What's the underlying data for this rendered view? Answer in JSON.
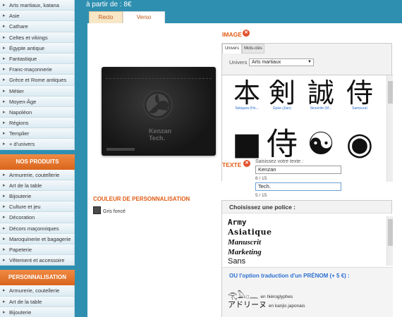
{
  "sidebar": {
    "categories": [
      "Arts martiaux, katana",
      "Asie",
      "Cathare",
      "Celtes et vikings",
      "Égypte antique",
      "Fantastique",
      "Franc-maçonnerie",
      "Grèce et Rome antiques",
      "Métier",
      "Moyen-Âge",
      "Napoléon",
      "Régions",
      "Templier",
      "+ d'univers"
    ],
    "produits_heading": "NOS PRODUITS",
    "produits": [
      "Armurerie, coutellerie",
      "Art de la table",
      "Bijouterie",
      "Culture et jeu",
      "Décoration",
      "Décors maçonniques",
      "Maroquinerie et bagagerie",
      "Papeterie",
      "Vêtement et accessoire"
    ],
    "perso_heading": "PERSONNALISATION",
    "perso": [
      "Armurerie, coutellerie",
      "Art de la table",
      "Bijouterie"
    ]
  },
  "header": {
    "price": "à partir de : 8€"
  },
  "tabs": {
    "recto": "Recto",
    "verso": "Verso"
  },
  "product": {
    "engraving_line1": "Kenzan",
    "engraving_line2": "Tech."
  },
  "couleur": {
    "title": "COULEUR DE PERSONNALISATION",
    "swatch_label": "Gris foncé",
    "swatch_color": "#4a4a4a"
  },
  "image_section": {
    "title": "IMAGE",
    "tab_univers": "Univers",
    "tab_mots": "Mots-clés",
    "univers_label": "Univers :",
    "univers_value": "Arts martiaux",
    "symbols_row1": [
      {
        "glyph": "本",
        "caption": "Sekigara (Ho..."
      },
      {
        "glyph": "剣",
        "caption": "Épée (Jian)"
      },
      {
        "glyph": "誠",
        "caption": "Sincérité (M..."
      },
      {
        "glyph": "侍",
        "caption": "Samouraï"
      }
    ],
    "symbols_row2": [
      {
        "glyph": "■",
        "caption": ""
      },
      {
        "glyph": "侍",
        "caption": ""
      },
      {
        "glyph": "☯",
        "caption": ""
      },
      {
        "glyph": "◉",
        "caption": ""
      }
    ]
  },
  "texte_section": {
    "title": "TEXTE",
    "prompt": "Saisissez votre texte :",
    "line1_value": "Kenzan",
    "line1_count": "6 / 15",
    "line2_value": "Tech.",
    "line2_count": "5 / 15"
  },
  "police_section": {
    "title": "Choisissez une police :",
    "fonts": [
      "Army",
      "Asiatique",
      "Manuscrit",
      "Marketing",
      "Sans"
    ],
    "traduction_title": "OU l'option traduction d'un PRÉNOM (+ 5 €) :",
    "trad_hieroglyph_glyph": "𓂀𓅓𓊪𓈖",
    "trad_hieroglyph_label": "en hiéroglyphes",
    "trad_kanji_glyph": "アドリーヌ",
    "trad_kanji_label": "en kanjis japonais"
  }
}
